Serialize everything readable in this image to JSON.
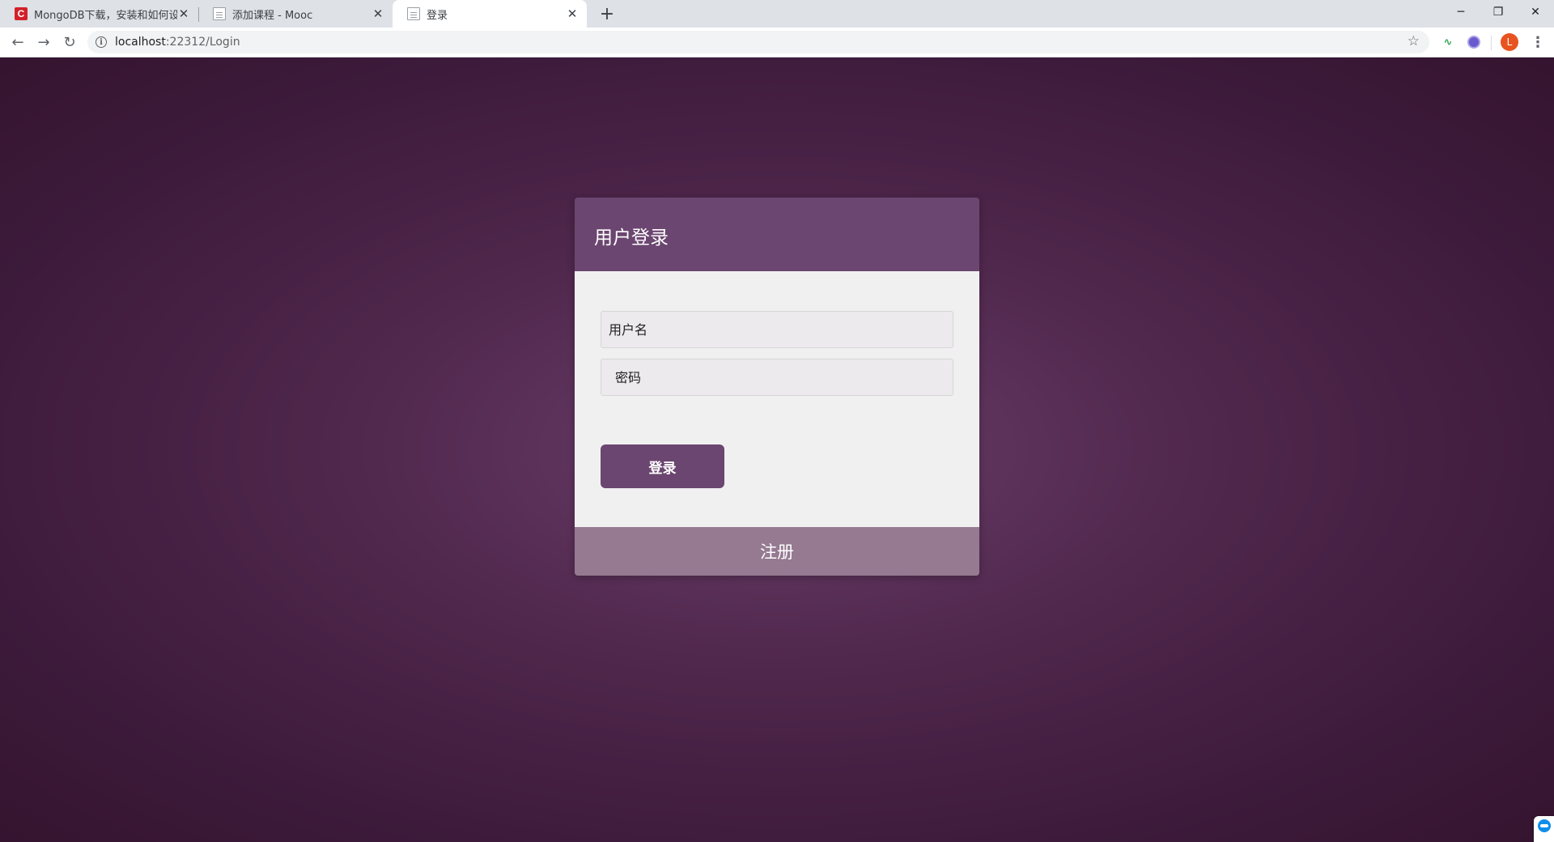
{
  "browser": {
    "tabs": [
      {
        "title": "MongoDB下载，安装和如何设置",
        "favicon": "c-logo-icon",
        "active": false
      },
      {
        "title": "添加课程 - Mooc",
        "favicon": "document-icon",
        "active": false
      },
      {
        "title": "登录",
        "favicon": "document-icon",
        "active": true
      }
    ],
    "new_tab": "+",
    "window_controls": {
      "minimize": "─",
      "restore": "❐",
      "close": "✕"
    },
    "url_host": "localhost",
    "url_path": ":22312/Login",
    "avatar_letter": "L"
  },
  "login_card": {
    "title": "用户登录",
    "username_placeholder": "用户名",
    "password_placeholder": "密码",
    "login_button": "登录",
    "register_link": "注册"
  },
  "colors": {
    "header": "#6b4670",
    "footer": "#957a92",
    "background": "#4a2346"
  }
}
